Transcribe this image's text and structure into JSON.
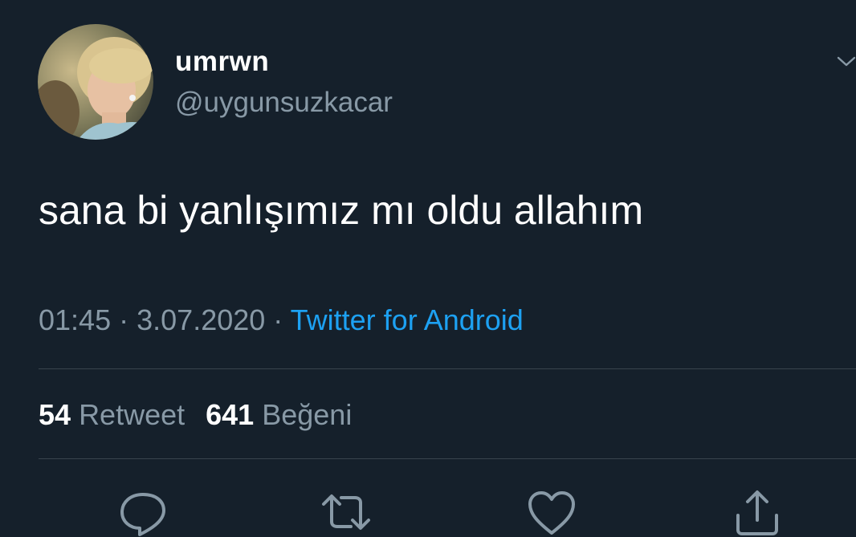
{
  "user": {
    "display_name": "umrwn",
    "handle": "@uygunsuzkacar"
  },
  "tweet": {
    "text": "sana bi yanlışımız mı oldu allahım",
    "time": "01:45",
    "separator": "·",
    "date": "3.07.2020",
    "source": "Twitter for Android"
  },
  "stats": {
    "retweets_count": "54",
    "retweets_label": "Retweet",
    "likes_count": "641",
    "likes_label": "Beğeni"
  },
  "icons": {
    "menu": "chevron-down-icon",
    "reply": "reply-icon",
    "retweet": "retweet-icon",
    "like": "heart-icon",
    "share": "share-icon"
  },
  "colors": {
    "background": "#15202b",
    "text_primary": "#ffffff",
    "text_secondary": "#8899a6",
    "accent": "#1da1f2",
    "divider": "#38444d"
  }
}
